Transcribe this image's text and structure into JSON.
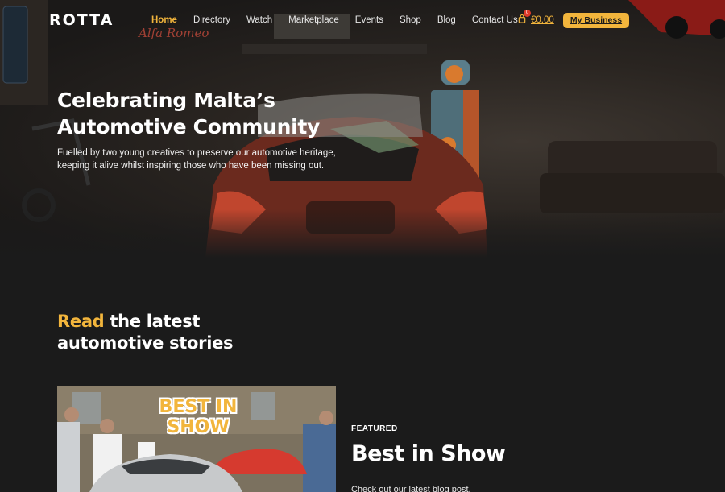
{
  "brand": {
    "logo": "ROTTA"
  },
  "nav": {
    "items": [
      {
        "label": "Home",
        "active": true
      },
      {
        "label": "Directory"
      },
      {
        "label": "Watch"
      },
      {
        "label": "Marketplace"
      },
      {
        "label": "Events"
      },
      {
        "label": "Shop"
      },
      {
        "label": "Blog"
      },
      {
        "label": "Contact Us"
      }
    ],
    "cart": {
      "count": "0",
      "total": "€0.00"
    },
    "business_button": "My Business"
  },
  "hero": {
    "title": "Celebrating Malta’s Automotive Community",
    "subtitle": "Fuelled by two young creatives to preserve our automotive heritage, keeping it alive whilst inspiring those who have been missing out."
  },
  "read_section": {
    "title_accent": "Read",
    "title_rest_1": " the latest",
    "title_rest_2": "automotive stories"
  },
  "featured_post": {
    "image_text": "BEST IN SHOW",
    "label": "FEATURED",
    "title": "Best in Show",
    "excerpt": "Check out our latest blog post."
  },
  "colors": {
    "accent": "#f2b53c",
    "background": "#1b1b1b",
    "badge": "#e03a2a"
  }
}
